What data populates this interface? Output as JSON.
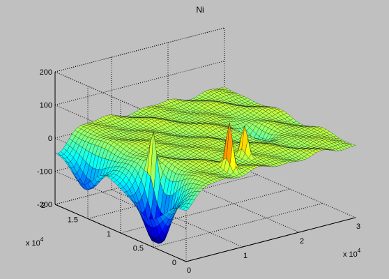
{
  "chart_data": {
    "type": "surface",
    "title": "Ni",
    "colormap": "jet",
    "grid": true,
    "xlim": [
      0,
      30000
    ],
    "ylim": [
      0,
      20000
    ],
    "zlim": [
      -200,
      200
    ],
    "x_ticks": [
      0,
      1,
      2,
      3
    ],
    "y_ticks": [
      0,
      0.5,
      1,
      1.5,
      2
    ],
    "z_ticks": [
      -200,
      -100,
      0,
      100,
      200
    ],
    "x_exponent": "x 10",
    "x_exponent_power": "4",
    "y_exponent": "x 10",
    "y_exponent_power": "4",
    "baseline_z": 20,
    "features": [
      {
        "x": 1000,
        "y": 16000,
        "z": -95,
        "kind": "trough"
      },
      {
        "x": 2000,
        "y": 6000,
        "z": -200,
        "kind": "trough"
      },
      {
        "x": 3500,
        "y": 8000,
        "z": 150,
        "kind": "peak"
      },
      {
        "x": 10000,
        "y": 2000,
        "z": 155,
        "kind": "peak"
      },
      {
        "x": 15000,
        "y": 4000,
        "z": 110,
        "kind": "peak"
      },
      {
        "x": 23000,
        "y": 9000,
        "z": -45,
        "kind": "trough"
      }
    ]
  }
}
